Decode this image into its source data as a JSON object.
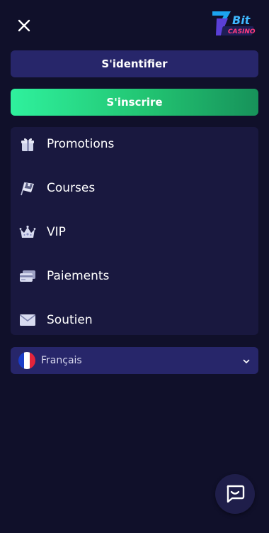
{
  "header": {
    "close_icon": "close-icon",
    "logo_text": "7Bit CASINO"
  },
  "auth": {
    "login_label": "S'identifier",
    "register_label": "S'inscrire"
  },
  "menu": {
    "items": [
      {
        "label": "Promotions",
        "icon": "gift-icon"
      },
      {
        "label": "Courses",
        "icon": "race-flag-icon"
      },
      {
        "label": "VIP",
        "icon": "crown-icon"
      },
      {
        "label": "Paiements",
        "icon": "card-icon"
      },
      {
        "label": "Soutien",
        "icon": "mail-icon"
      }
    ]
  },
  "language": {
    "selected": "Français",
    "flag": "fr-flag-icon"
  },
  "chat": {
    "icon": "chat-icon"
  },
  "colors": {
    "background": "#10102a",
    "login_button": "#27266a",
    "register_button": "#22c472",
    "menu_panel": "#19183f"
  }
}
